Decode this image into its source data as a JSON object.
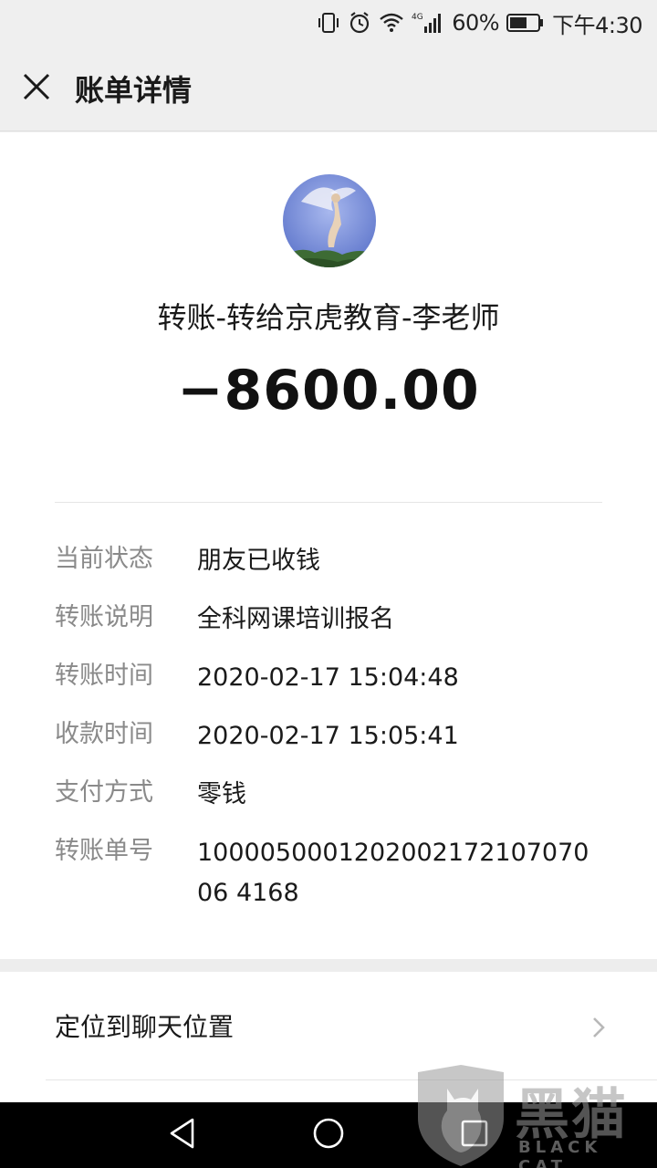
{
  "status_bar": {
    "battery": "60%",
    "time": "下午4:30",
    "network": "4G"
  },
  "nav": {
    "title": "账单详情"
  },
  "bill": {
    "payee": "转账-转给京虎教育-李老师",
    "amount": "−8600.00",
    "fields": [
      {
        "label": "当前状态",
        "value": "朋友已收钱"
      },
      {
        "label": "转账说明",
        "value": "全科网课培训报名"
      },
      {
        "label": "转账时间",
        "value": "2020-02-17 15:04:48"
      },
      {
        "label": "收款时间",
        "value": "2020-02-17 15:05:41"
      },
      {
        "label": "支付方式",
        "value": "零钱"
      },
      {
        "label": "转账单号",
        "value": "100005000120200217210707006 4168"
      }
    ]
  },
  "locate": {
    "label": "定位到聊天位置"
  },
  "watermark": {
    "text": "黑猫",
    "sub": "BLACK CAT"
  },
  "icons": [
    "vibrate-icon",
    "alarm-icon",
    "wifi-icon",
    "signal-icon",
    "battery-icon",
    "close-icon",
    "chevron-right-icon",
    "back-triangle-icon",
    "home-circle-icon",
    "recents-square-icon"
  ]
}
